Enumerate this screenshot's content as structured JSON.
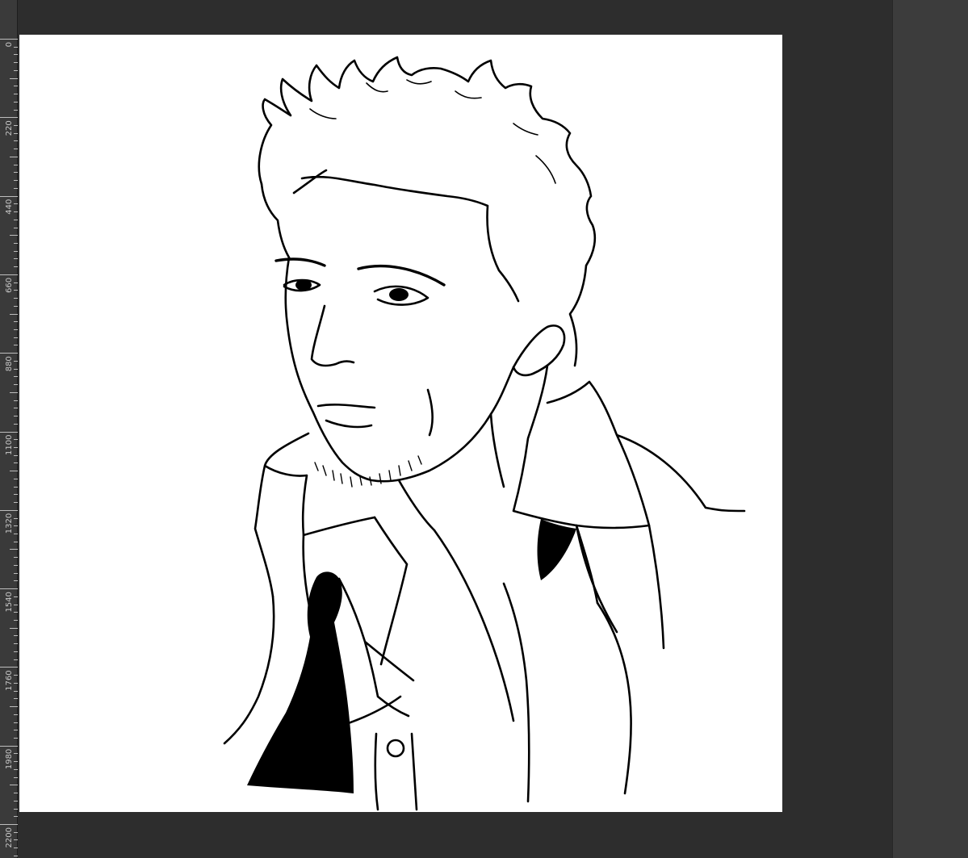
{
  "ruler": {
    "labels": [
      "0",
      "220",
      "440",
      "660",
      "880",
      "1100",
      "1320",
      "1540",
      "1760",
      "1980",
      "2200"
    ]
  },
  "canvas": {
    "background": "#ffffff",
    "artwork": "drawing"
  },
  "colors": {
    "app_bg": "#323232",
    "ruler_bg": "#3a3a3a",
    "panel_bg": "#3c3c3c",
    "ink": "#000000"
  }
}
